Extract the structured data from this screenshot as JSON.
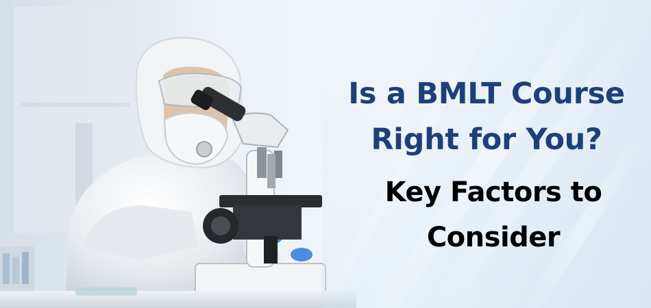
{
  "headline": {
    "line1": "Is a BMLT Course",
    "line2": "Right for You?"
  },
  "subheadline": {
    "line1": "Key Factors to",
    "line2": "Consider"
  },
  "colors": {
    "headline": "#1f3f7a",
    "subheadline": "#000000",
    "background": "#eef4f9"
  },
  "photo": {
    "subject": "lab-technician-with-microscope"
  }
}
